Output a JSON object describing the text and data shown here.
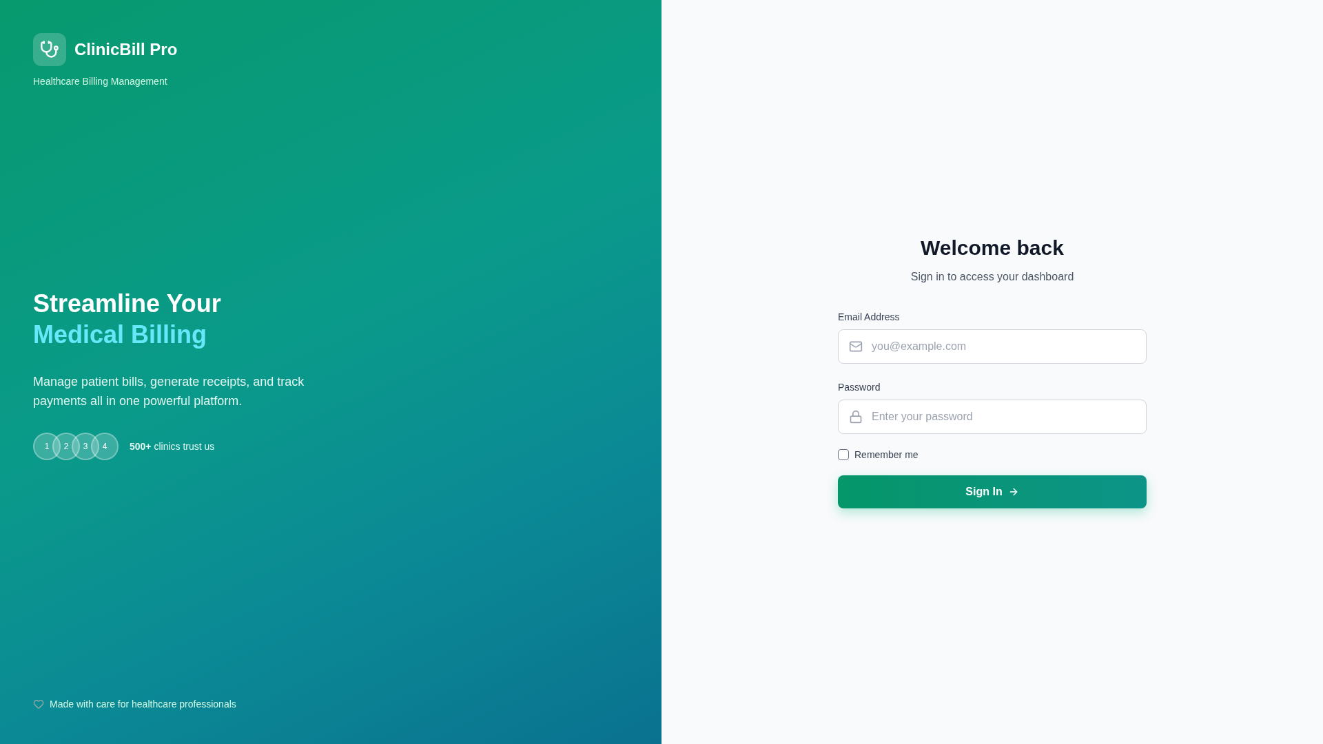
{
  "brand": {
    "name": "ClinicBill Pro",
    "tagline": "Healthcare Billing Management"
  },
  "hero": {
    "title_line_1": "Streamline Your",
    "title_line_2": "Medical Billing",
    "description": "Manage patient bills, generate receipts, and track payments all in one powerful platform.",
    "avatars": [
      "1",
      "2",
      "3",
      "4"
    ],
    "trust": "**500+** clinics trust us"
  },
  "footer": "Made with care for healthcare professionals",
  "form": {
    "title": "Welcome back",
    "subtitle": "Sign in to access your dashboard",
    "fields": [
      {
        "kind": "email",
        "label": "Email Address",
        "placeholder": "you@example.com"
      },
      {
        "kind": "password",
        "label": "Password",
        "placeholder": "Enter your password"
      }
    ],
    "remember": {
      "label": "Remember me",
      "checked": false
    },
    "submit": "Sign In"
  }
}
